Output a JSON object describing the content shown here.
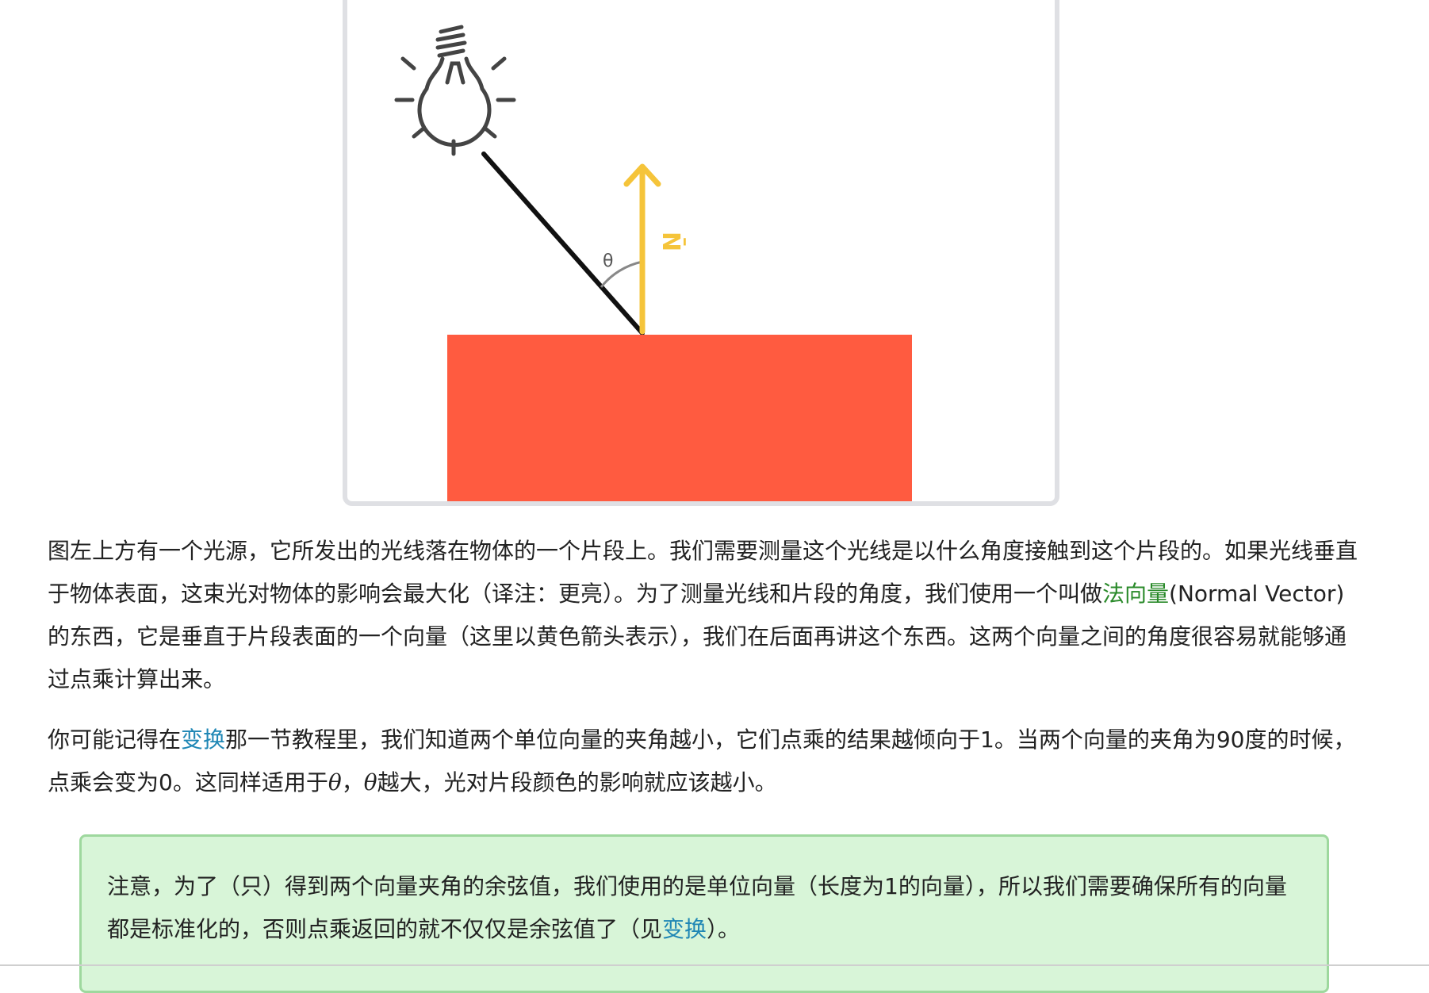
{
  "figure": {
    "theta_label": "θ",
    "normal_label": "N̄",
    "colors": {
      "surface": "#ff5b40",
      "normal_arrow": "#f5c43a",
      "light_ray": "#111111",
      "bulb": "#444444"
    }
  },
  "para1": {
    "t1": "图左上方有一个光源，它所发出的光线落在物体的一个片段上。我们需要测量这个光线是以什么角度接触到这个片段的。如果光线垂直于物体表面，这束光对物体的影响会最大化（译注：更亮）。为了测量光线和片段的角度，我们使用一个叫做",
    "link": "法向量",
    "t2": "(Normal Vector)的东西，它是垂直于片段表面的一个向量（这里以黄色箭头表示），我们在后面再讲这个东西。这两个向量之间的角度很容易就能够通过点乘计算出来。"
  },
  "para2": {
    "t1": "你可能记得在",
    "link": "变换",
    "t2": "那一节教程里，我们知道两个单位向量的夹角越小，它们点乘的结果越倾向于1。当两个向量的夹角为90度的时候，点乘会变为0。这同样适用于",
    "theta1": "θ",
    "sep": "，",
    "theta2": "θ",
    "t3": "越大，光对片段颜色的影响就应该越小。"
  },
  "note": {
    "t1": "注意，为了（只）得到两个向量夹角的余弦值，我们使用的是单位向量（长度为1的向量），所以我们需要确保所有的向量都是标准化的，否则点乘返回的就不仅仅是余弦值了（见",
    "link": "变换",
    "t2": "）。"
  }
}
